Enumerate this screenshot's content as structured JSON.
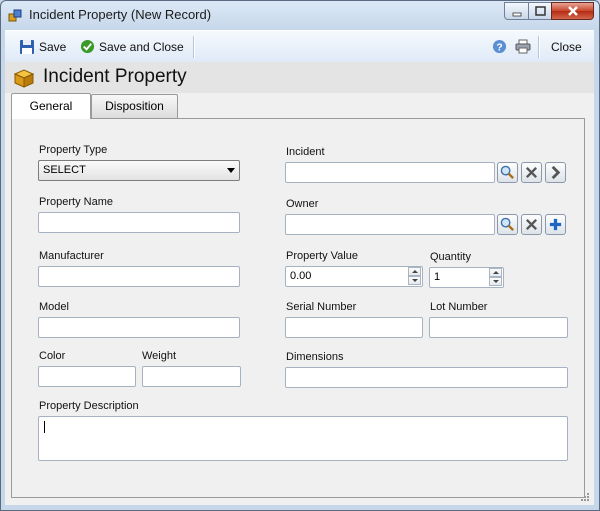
{
  "window": {
    "title": "Incident Property (New Record)"
  },
  "toolbar": {
    "save_label": "Save",
    "save_close_label": "Save and Close",
    "close_label": "Close"
  },
  "header": {
    "title": "Incident Property"
  },
  "tabs": [
    {
      "label": "General",
      "active": true
    },
    {
      "label": "Disposition",
      "active": false
    }
  ],
  "form": {
    "property_type": {
      "label": "Property Type",
      "value": "SELECT"
    },
    "incident": {
      "label": "Incident",
      "value": ""
    },
    "property_name": {
      "label": "Property Name",
      "value": ""
    },
    "owner": {
      "label": "Owner",
      "value": ""
    },
    "manufacturer": {
      "label": "Manufacturer",
      "value": ""
    },
    "property_value": {
      "label": "Property Value",
      "value": "0.00"
    },
    "quantity": {
      "label": "Quantity",
      "value": "1"
    },
    "model": {
      "label": "Model",
      "value": ""
    },
    "serial_number": {
      "label": "Serial Number",
      "value": ""
    },
    "lot_number": {
      "label": "Lot Number",
      "value": ""
    },
    "color": {
      "label": "Color",
      "value": ""
    },
    "weight": {
      "label": "Weight",
      "value": ""
    },
    "dimensions": {
      "label": "Dimensions",
      "value": ""
    },
    "property_description": {
      "label": "Property Description",
      "value": ""
    }
  },
  "icons": {
    "window": "package-icon",
    "save": "floppy-disk-icon",
    "save_close": "check-circle-icon",
    "help": "help-icon",
    "print": "printer-icon",
    "search": "magnifier-icon",
    "clear": "x-icon",
    "navigate": "chevron-right-icon",
    "add": "plus-icon"
  },
  "colors": {
    "toolbar_bg": "#e8f0fa",
    "close_button": "#c8452c",
    "panel_bg": "#f0f0f0"
  }
}
